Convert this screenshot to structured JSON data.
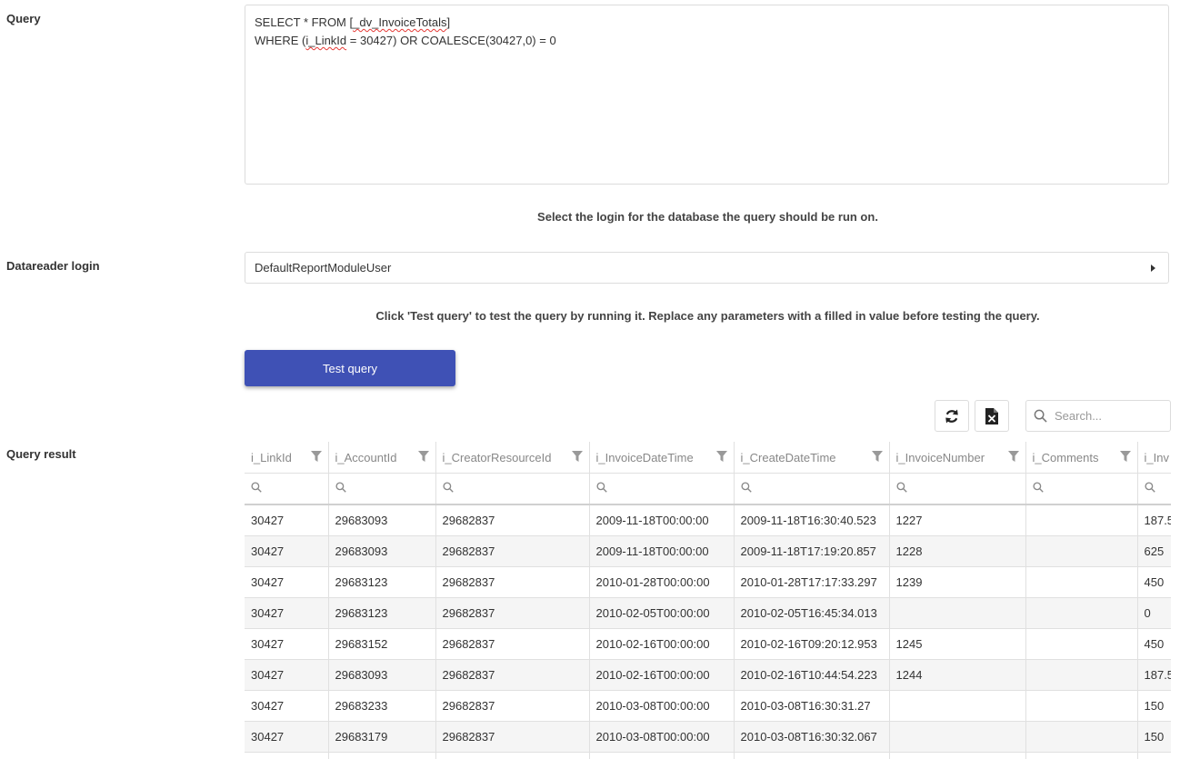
{
  "labels": {
    "query": "Query",
    "datareader_login": "Datareader login",
    "query_result": "Query result"
  },
  "query": {
    "line1_a": "SELECT * FROM [",
    "line1_b": "_dv_InvoiceTotals",
    "line1_c": "]",
    "line2_a": "WHERE (",
    "line2_b": "i_LinkId",
    "line2_c": " = 30427) OR COALESCE(30427,0) = 0"
  },
  "hints": {
    "select_login": "Select the login for the database the query should be run on.",
    "test_query": "Click 'Test query' to test the query by running it. Replace any parameters with a filled in value before testing the query."
  },
  "login_select": {
    "value": "DefaultReportModuleUser"
  },
  "test_button": {
    "label": "Test query"
  },
  "search": {
    "placeholder": "Search..."
  },
  "icons": {
    "refresh": "refresh-icon",
    "export": "excel-export-icon",
    "search": "search-icon",
    "filter": "filter-icon"
  },
  "colors": {
    "primary": "#3f51b5"
  },
  "grid": {
    "columns": [
      "i_LinkId",
      "i_AccountId",
      "i_CreatorResourceId",
      "i_InvoiceDateTime",
      "i_CreateDateTime",
      "i_InvoiceNumber",
      "i_Comments",
      "i_Inv"
    ],
    "rows": [
      [
        "30427",
        "29683093",
        "29682837",
        "2009-11-18T00:00:00",
        "2009-11-18T16:30:40.523",
        "1227",
        "",
        "187.5"
      ],
      [
        "30427",
        "29683093",
        "29682837",
        "2009-11-18T00:00:00",
        "2009-11-18T17:19:20.857",
        "1228",
        "",
        "625"
      ],
      [
        "30427",
        "29683123",
        "29682837",
        "2010-01-28T00:00:00",
        "2010-01-28T17:17:33.297",
        "1239",
        "",
        "450"
      ],
      [
        "30427",
        "29683123",
        "29682837",
        "2010-02-05T00:00:00",
        "2010-02-05T16:45:34.013",
        "",
        "",
        "0"
      ],
      [
        "30427",
        "29683152",
        "29682837",
        "2010-02-16T00:00:00",
        "2010-02-16T09:20:12.953",
        "1245",
        "",
        "450"
      ],
      [
        "30427",
        "29683093",
        "29682837",
        "2010-02-16T00:00:00",
        "2010-02-16T10:44:54.223",
        "1244",
        "",
        "187.5"
      ],
      [
        "30427",
        "29683233",
        "29682837",
        "2010-03-08T00:00:00",
        "2010-03-08T16:30:31.27",
        "",
        "",
        "150"
      ],
      [
        "30427",
        "29683179",
        "29682837",
        "2010-03-08T00:00:00",
        "2010-03-08T16:30:32.067",
        "",
        "",
        "150"
      ],
      [
        "",
        "",
        "",
        "",
        "",
        "",
        "",
        ""
      ]
    ]
  }
}
